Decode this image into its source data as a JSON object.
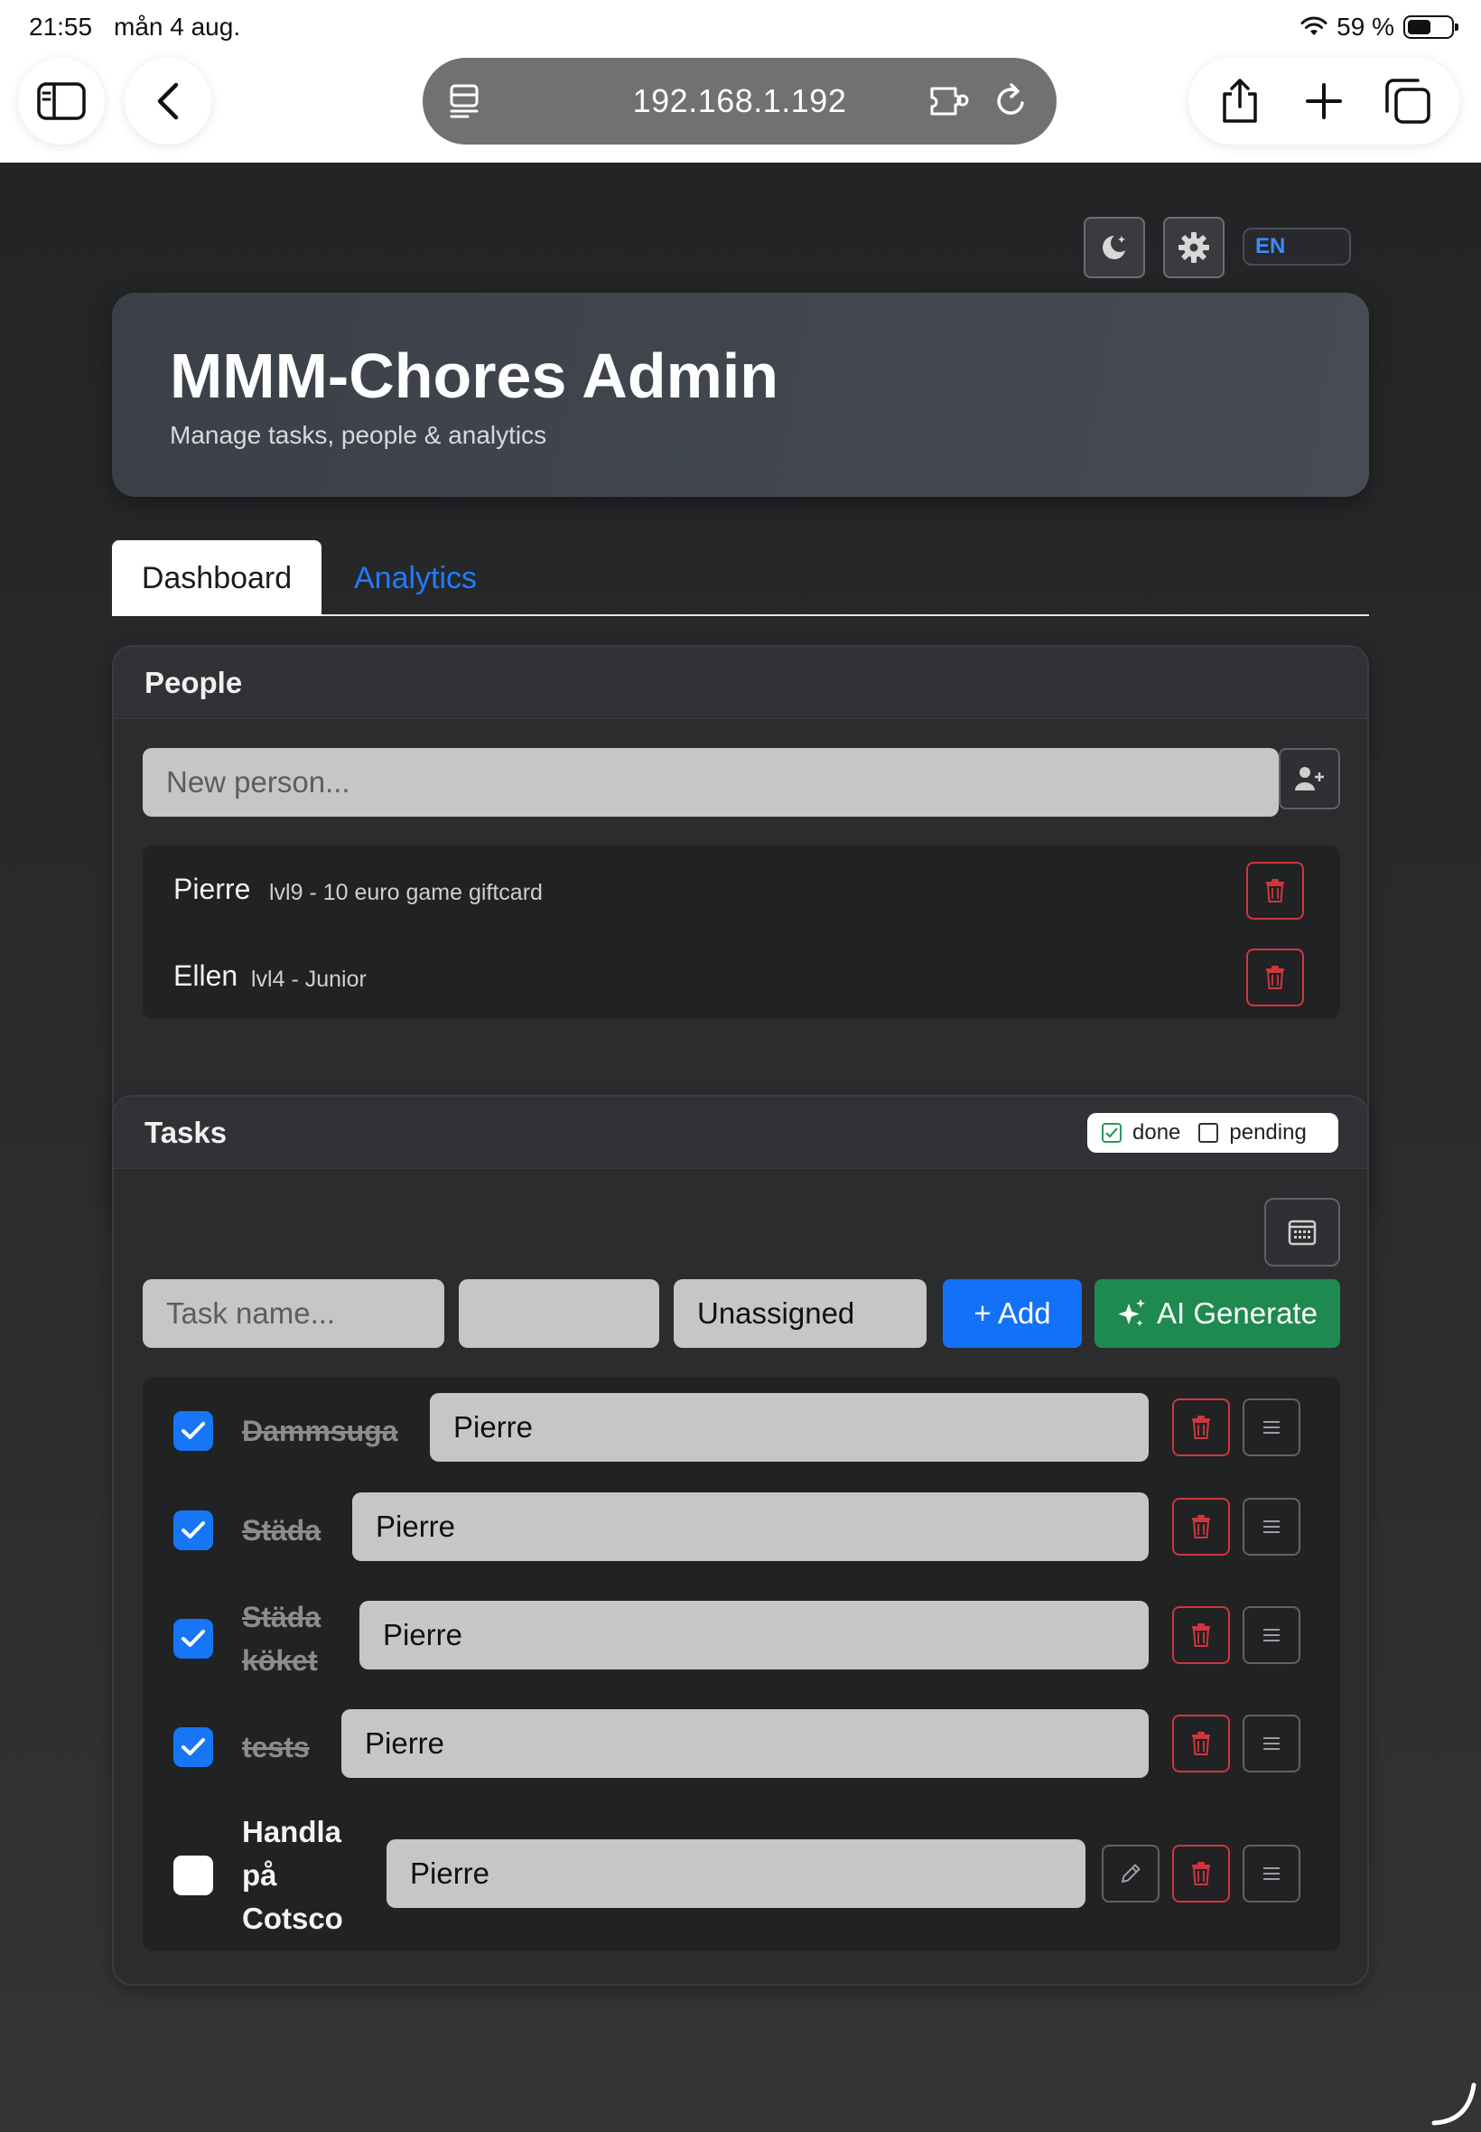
{
  "status_bar": {
    "time": "21:55",
    "date": "mån 4 aug.",
    "battery": "59 %"
  },
  "browser": {
    "url": "192.168.1.192"
  },
  "topbar": {
    "language": "EN"
  },
  "header": {
    "title": "MMM-Chores Admin",
    "subtitle": "Manage tasks, people & analytics"
  },
  "tabs": [
    {
      "label": "Dashboard"
    },
    {
      "label": "Analytics"
    }
  ],
  "people": {
    "title": "People",
    "input_placeholder": "New person...",
    "items": [
      {
        "name": "Pierre",
        "meta": "lvl9 - 10 euro game giftcard"
      },
      {
        "name": "Ellen",
        "meta": "lvl4 - Junior"
      }
    ]
  },
  "tasks": {
    "title": "Tasks",
    "legend": {
      "done": "done",
      "pending": "pending"
    },
    "form": {
      "name_placeholder": "Task name...",
      "date_value": "",
      "assignee_value": "Unassigned",
      "add_label": "+ Add",
      "ai_label": "AI Generate"
    },
    "items": [
      {
        "name": "Dammsuga",
        "done": true,
        "assignee": "Pierre"
      },
      {
        "name": "Städa",
        "done": true,
        "assignee": "Pierre"
      },
      {
        "name_lines": [
          "Städa",
          "köket"
        ],
        "done": true,
        "assignee": "Pierre"
      },
      {
        "name": "tests",
        "done": true,
        "assignee": "Pierre"
      },
      {
        "name_lines": [
          "Handla",
          "på",
          "Cotsco"
        ],
        "done": false,
        "assignee": "Pierre"
      }
    ]
  },
  "colors": {
    "accent": "#1271f7",
    "success": "#1f8a4f",
    "danger": "#d0363f"
  }
}
